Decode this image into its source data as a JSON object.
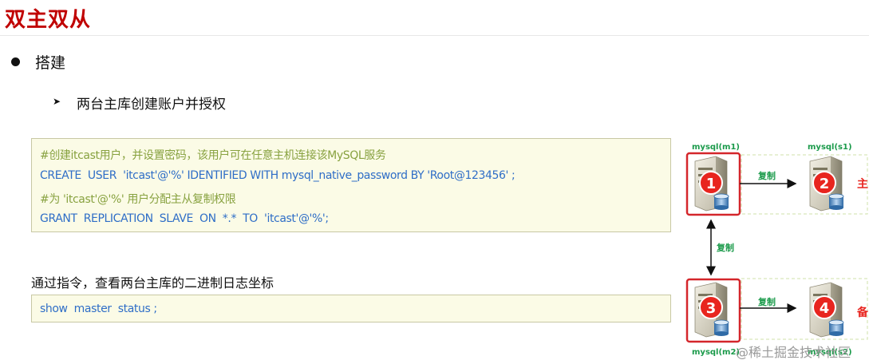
{
  "page": {
    "title": "双主双从"
  },
  "section": {
    "bullet_label": "搭建",
    "sub_label": "两台主库创建账户并授权"
  },
  "code_block_1": {
    "lines": [
      "#创建itcast用户，并设置密码，该用户可在任意主机连接该MySQL服务",
      "CREATE  USER  'itcast'@'%' IDENTIFIED WITH mysql_native_password BY 'Root@123456' ;",
      "#为 'itcast'@'%' 用户分配主从复制权限",
      "GRANT  REPLICATION  SLAVE  ON  *.*  TO  'itcast'@'%';"
    ]
  },
  "description": {
    "text": "通过指令，查看两台主库的二进制日志坐标"
  },
  "code_block_2": {
    "line": "show  master  status ;"
  },
  "diagram": {
    "nodes": [
      {
        "label": "mysql(m1)",
        "number": "1"
      },
      {
        "label": "mysql(s1)",
        "number": "2"
      },
      {
        "label": "mysql(m2)",
        "number": "3"
      },
      {
        "label": "mysql(s2)",
        "number": "4"
      }
    ],
    "edge_label_top": "复制",
    "edge_label_mid": "复制",
    "edge_label_bottom": "复制",
    "side_label_top": "主",
    "side_label_bottom": "备"
  },
  "watermark": "@稀土掘金技术社区",
  "colors": {
    "title_red": "#c00000",
    "comment_green": "#88a240",
    "code_blue": "#2f6ec7",
    "code_bg": "#fbfbe6",
    "server_highlight": "#d4262b",
    "badge_red": "#e8251f",
    "edge_label_green": "#1a9a4a"
  }
}
